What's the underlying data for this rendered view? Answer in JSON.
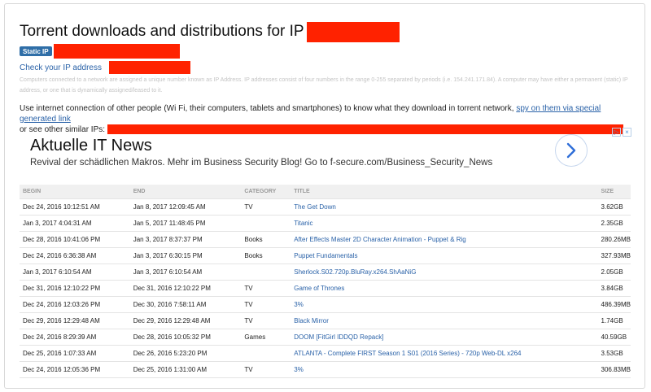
{
  "page": {
    "title": "Torrent downloads and distributions for IP",
    "badge": "Static IP",
    "check_link": "Check your IP address",
    "hint": "Computers connected to a network are assigned a unique number known as IP Address. IP addresses consist of four numbers in the range 0-255 separated by periods (i.e. 154.241.171.84). A computer may have either a permanent (static) IP address, or one that is dynamically assigned/leased to it.",
    "info_text": "Use internet connection of other people (Wi Fi, their computers, tablets and smartphones) to know what they download in torrent network,",
    "spy_link": "spy on them via special generated link",
    "similar_text": "or see other similar IPs:",
    "redaction_color": "#ff2200"
  },
  "ad": {
    "headline": "Aktuelle IT News",
    "body": "Revival der schädlichen Makros. Mehr im Business Security Blog! Go to f-secure.com/Business_Security_News",
    "arrow_icon": "chevron-right-icon",
    "choices_icons": [
      "ad-choices-icon",
      "close-icon"
    ]
  },
  "table": {
    "headers": [
      "BEGIN",
      "END",
      "CATEGORY",
      "TITLE",
      "SIZE"
    ],
    "rows": [
      {
        "begin": "Dec 24, 2016 10:12:51 AM",
        "end": "Jan 8, 2017 12:09:45 AM",
        "category": "TV",
        "title": "The Get Down",
        "size": "3.62GB"
      },
      {
        "begin": "Jan 3, 2017 4:04:31 AM",
        "end": "Jan 5, 2017 11:48:45 PM",
        "category": "",
        "title": "Titanic",
        "size": "2.35GB"
      },
      {
        "begin": "Dec 28, 2016 10:41:06 PM",
        "end": "Jan 3, 2017 8:37:37 PM",
        "category": "Books",
        "title": "After Effects Master 2D Character Animation - Puppet & Rig",
        "size": "280.26MB"
      },
      {
        "begin": "Dec 24, 2016 6:36:38 AM",
        "end": "Jan 3, 2017 6:30:15 PM",
        "category": "Books",
        "title": "Puppet Fundamentals",
        "size": "327.93MB"
      },
      {
        "begin": "Jan 3, 2017 6:10:54 AM",
        "end": "Jan 3, 2017 6:10:54 AM",
        "category": "",
        "title": "Sherlock.S02.720p.BluRay.x264.ShAaNiG",
        "size": "2.05GB"
      },
      {
        "begin": "Dec 31, 2016 12:10:22 PM",
        "end": "Dec 31, 2016 12:10:22 PM",
        "category": "TV",
        "title": "Game of Thrones",
        "size": "3.84GB"
      },
      {
        "begin": "Dec 24, 2016 12:03:26 PM",
        "end": "Dec 30, 2016 7:58:11 AM",
        "category": "TV",
        "title": "3%",
        "size": "486.39MB"
      },
      {
        "begin": "Dec 29, 2016 12:29:48 AM",
        "end": "Dec 29, 2016 12:29:48 AM",
        "category": "TV",
        "title": "Black Mirror",
        "size": "1.74GB"
      },
      {
        "begin": "Dec 24, 2016 8:29:39 AM",
        "end": "Dec 28, 2016 10:05:32 PM",
        "category": "Games",
        "title": "DOOM [FitGirl IDDQD Repack]",
        "size": "40.59GB"
      },
      {
        "begin": "Dec 25, 2016 1:07:33 AM",
        "end": "Dec 26, 2016 5:23:20 PM",
        "category": "",
        "title": "ATLANTA - Complete FIRST Season 1 S01 (2016 Series) - 720p Web-DL x264",
        "size": "3.53GB"
      },
      {
        "begin": "Dec 24, 2016 12:05:36 PM",
        "end": "Dec 25, 2016 1:31:00 AM",
        "category": "TV",
        "title": "3%",
        "size": "306.83MB"
      }
    ]
  }
}
